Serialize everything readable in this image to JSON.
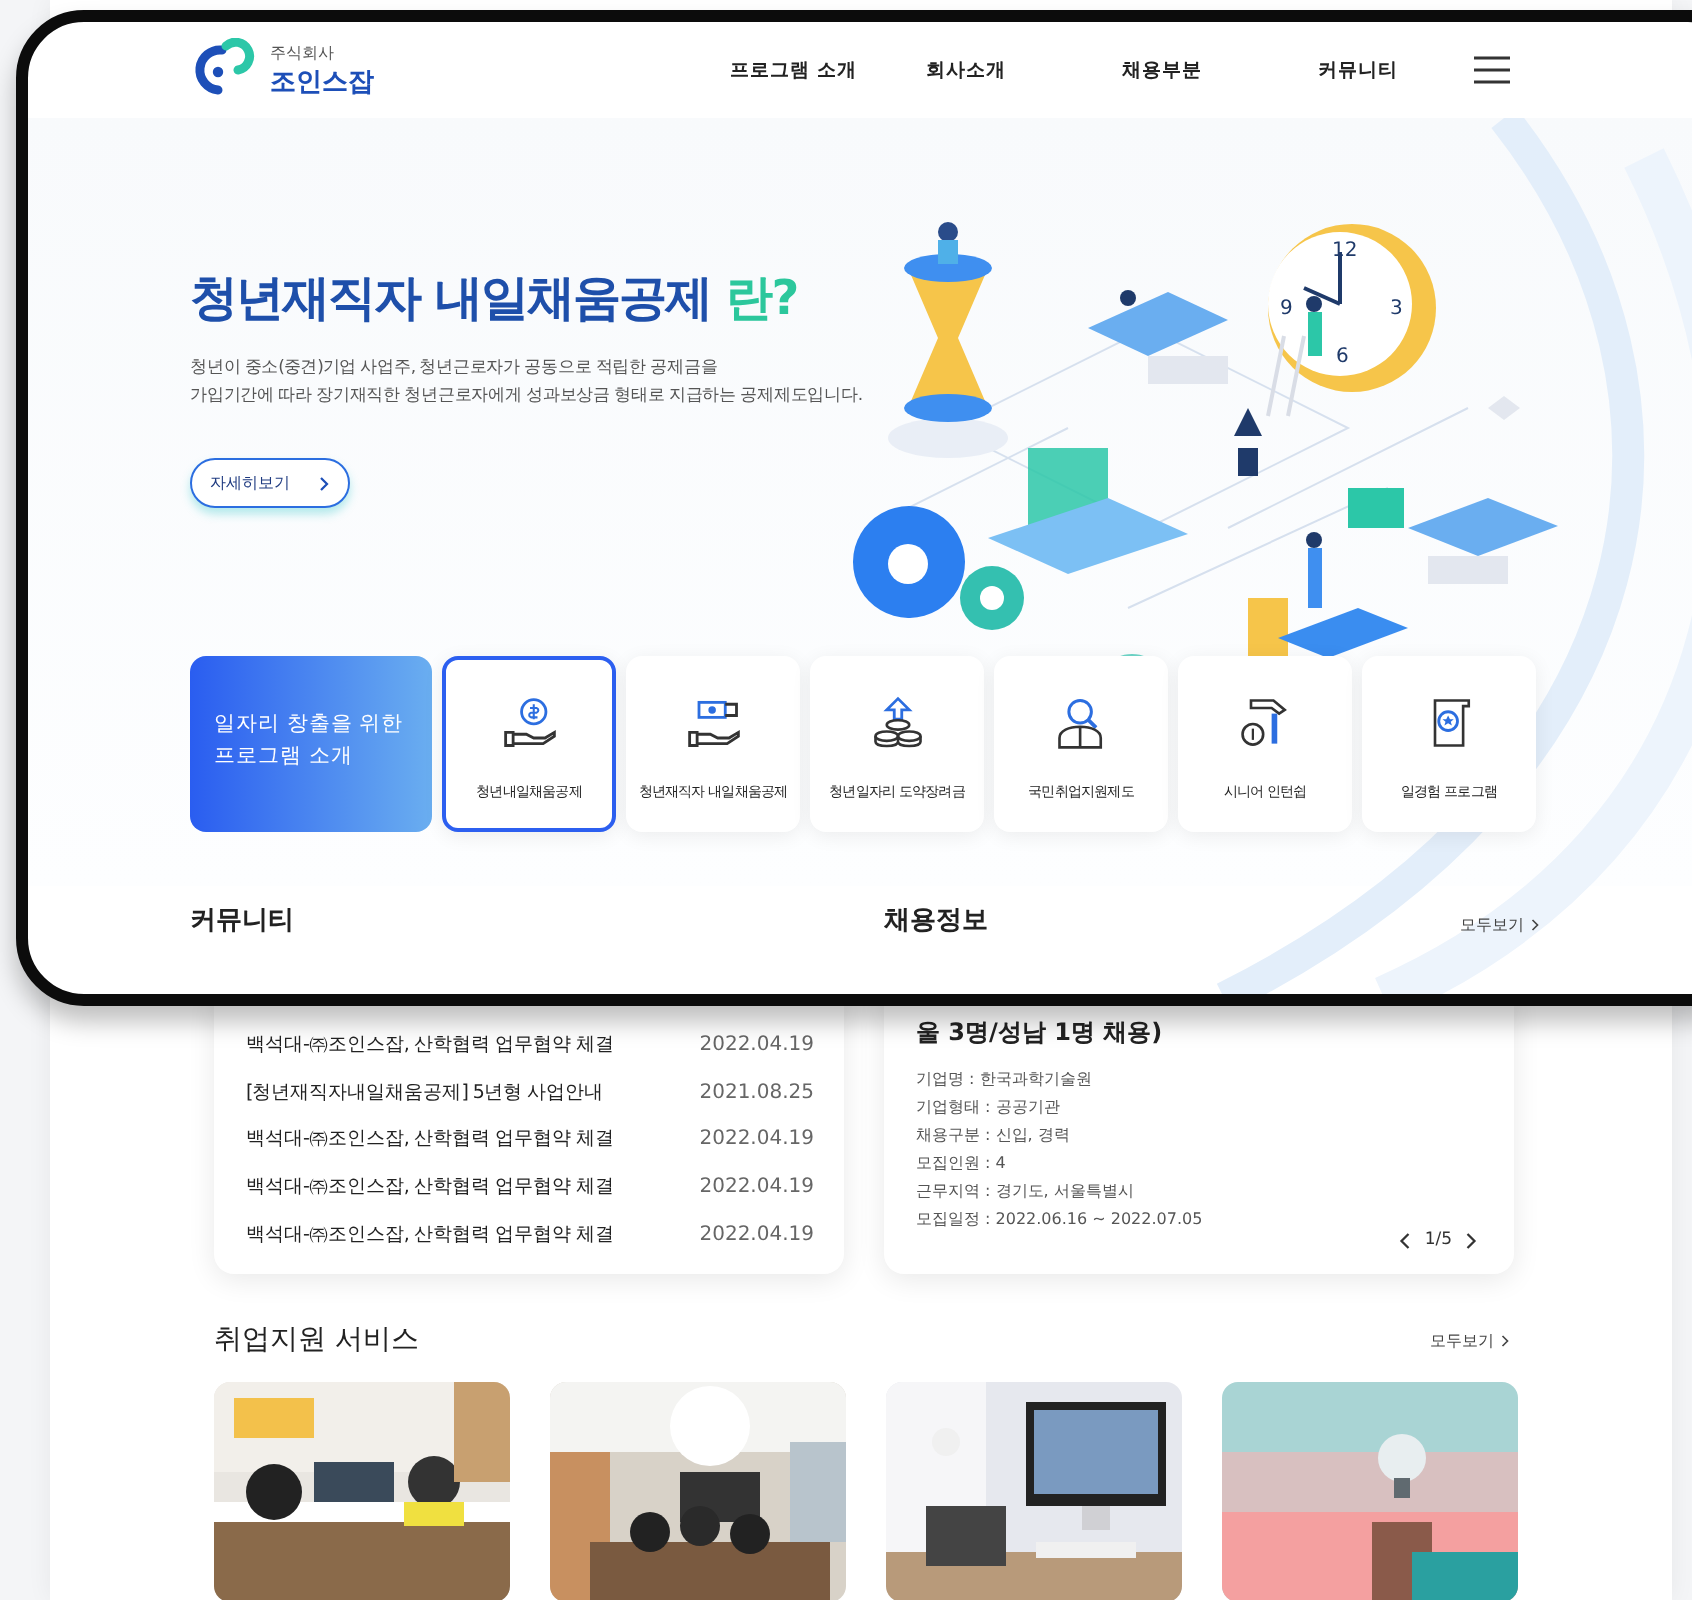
{
  "logo": {
    "small": "주식회사",
    "name": "조인스잡"
  },
  "nav": [
    "프로그램 소개",
    "회사소개",
    "채용부분",
    "커뮤니티"
  ],
  "hero": {
    "title": "청년재직자 내일채움공제",
    "title_accent": "란?",
    "description": [
      "청년이 중소(중견)기업 사업주, 청년근로자가 공동으로 적립한 공제금을",
      "가입기간에 따라 장기재직한 청년근로자에게 성과보상금 형태로 지급하는 공제제도입니다."
    ],
    "button": "자세히보기",
    "clock_numerals": [
      "12",
      "3",
      "6",
      "9"
    ]
  },
  "programs": {
    "intro": "일자리 창출을 위한 프로그램 소개",
    "items": [
      {
        "label": "청년내일채움공제",
        "selected": true
      },
      {
        "label": "청년재직자 내일채움공제",
        "selected": false
      },
      {
        "label": "청년일자리 도약장려금",
        "selected": false
      },
      {
        "label": "국민취업지원제도",
        "selected": false
      },
      {
        "label": "시니어 인턴쉽",
        "selected": false
      },
      {
        "label": "일경험 프로그램",
        "selected": false
      }
    ]
  },
  "sections": {
    "community_title": "커뮤니티",
    "jobs_title": "채용정보",
    "jobs_more": "모두보기"
  },
  "community": {
    "rows": [
      {
        "title": "백석대-㈜조인스잡, 산학협력 업무협약 체결",
        "date": "2022.04.19"
      },
      {
        "title": "[청년재직자내일채움공제] 5년형 사업안내",
        "date": "2021.08.25"
      },
      {
        "title": "백석대-㈜조인스잡, 산학협력 업무협약 체결",
        "date": "2022.04.19"
      },
      {
        "title": "백석대-㈜조인스잡, 산학협력 업무협약 체결",
        "date": "2022.04.19"
      },
      {
        "title": "백석대-㈜조인스잡, 산학협력 업무협약 체결",
        "date": "2022.04.19"
      }
    ]
  },
  "job": {
    "headline": "울 3명/성남 1명 채용)",
    "details": [
      "기업명 : 한국과학기술원",
      "기업형태 : 공공기관",
      "채용구분 : 신입, 경력",
      "모집인원 : 4",
      "근무지역 : 경기도, 서울특별시",
      "모집일정 : 2022.06.16 ~ 2022.07.05"
    ],
    "pager": "1/5"
  },
  "services": {
    "title": "취업지원 서비스",
    "more": "모두보기"
  }
}
